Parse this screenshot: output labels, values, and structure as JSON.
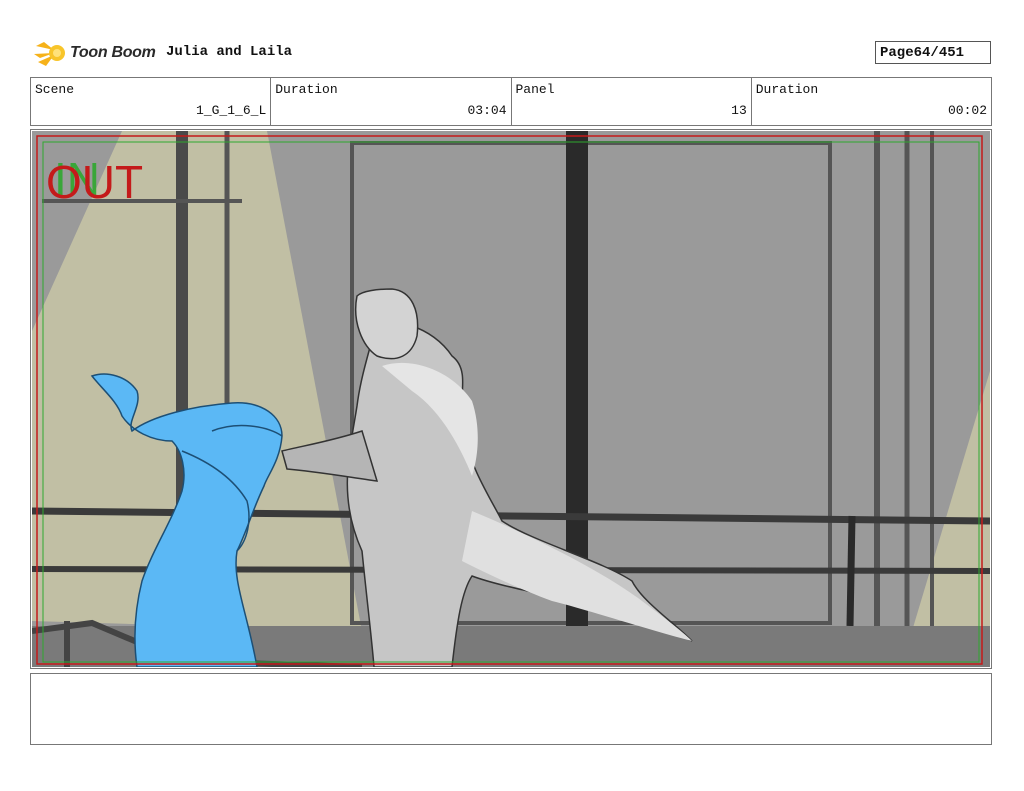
{
  "header": {
    "logo_text": "Toon Boom",
    "logo_icon": "toon-boom-star-icon",
    "project_title": "Julia and Laila",
    "page_label": "Page",
    "page_value": "64/451"
  },
  "info": {
    "scene_label": "Scene",
    "scene_value": "1_G_1_6_L",
    "duration_label": "Duration",
    "duration_value": "03:04",
    "panel_label": "Panel",
    "panel_value": "13",
    "panel_duration_label": "Duration",
    "panel_duration_value": "00:02"
  },
  "panel": {
    "in_marker": "IN",
    "out_marker": "OUT",
    "colors": {
      "in": "#2fa82f",
      "out": "#c41a1a",
      "background": "#9a9a9a",
      "left_character": "#5bb8f5",
      "right_character": "#c9c9c9"
    }
  },
  "notes": {}
}
